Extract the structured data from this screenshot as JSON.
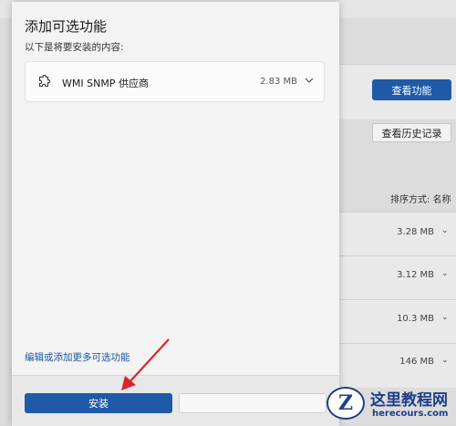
{
  "background": {
    "view_features_button": "查看功能",
    "view_history_button": "查看历史记录",
    "sort_label": "排序方式: 名称",
    "installed_sizes": [
      "3.28 MB",
      "3.12 MB",
      "10.3 MB",
      "146 MB"
    ]
  },
  "dialog": {
    "title": "添加可选功能",
    "subtitle": "以下是将要安装的内容:",
    "feature": {
      "icon": "puzzle-icon",
      "name": "WMI SNMP 供应商",
      "size": "2.83 MB"
    },
    "more_link": "编辑或添加更多可选功能",
    "install_button": "安装",
    "cancel_button": ""
  },
  "watermark": {
    "badge": "Z",
    "title": "这里教程网",
    "url": "herecours.com"
  },
  "colors": {
    "accent": "#1e5aa8",
    "link": "#1c57a5",
    "annotation_arrow": "#d9262b"
  }
}
